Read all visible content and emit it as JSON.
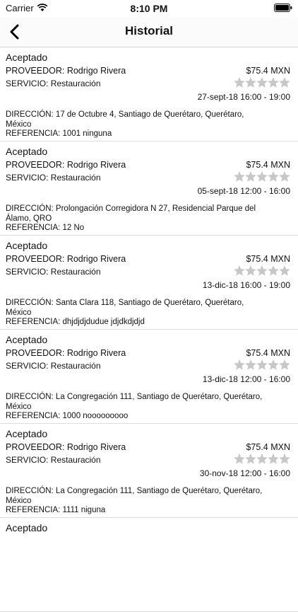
{
  "status_bar": {
    "carrier": "Carrier",
    "time": "8:10 PM"
  },
  "nav": {
    "title": "Historial"
  },
  "labels": {
    "provider_prefix": "PROVEEDOR: ",
    "service_prefix": "SERVICIO: ",
    "address_prefix": "DIRECCIÓN: ",
    "reference_prefix": "REFERENCIA: "
  },
  "items": [
    {
      "status": "Aceptado",
      "provider": "PROVEEDOR: Rodrigo Rivera",
      "price": "$75.4 MXN",
      "service": "SERVICIO: Restauración",
      "rating": 0,
      "datetime": "27-sept-18 16:00 - 19:00",
      "address": "DIRECCIÓN: 17 de Octubre 4, Santiago de Querétaro, Querétaro, México",
      "reference": "REFERENCIA: 1001 ninguna"
    },
    {
      "status": "Aceptado",
      "provider": "PROVEEDOR: Rodrigo Rivera",
      "price": "$75.4 MXN",
      "service": "SERVICIO: Restauración",
      "rating": 0,
      "datetime": "05-sept-18 12:00 - 16:00",
      "address": "DIRECCIÓN: Prolongación Corregidora N 27, Residencial Parque del Álamo, QRO",
      "reference": "REFERENCIA: 12 No"
    },
    {
      "status": "Aceptado",
      "provider": "PROVEEDOR: Rodrigo Rivera",
      "price": "$75.4 MXN",
      "service": "SERVICIO: Restauración",
      "rating": 0,
      "datetime": "13-dic-18 16:00 - 19:00",
      "address": "DIRECCIÓN: Santa Clara 118, Santiago de Querétaro, Querétaro, México",
      "reference": "REFERENCIA: dhjdjdjdudue jdjdkdjdjd"
    },
    {
      "status": "Aceptado",
      "provider": "PROVEEDOR: Rodrigo Rivera",
      "price": "$75.4 MXN",
      "service": "SERVICIO: Restauración",
      "rating": 0,
      "datetime": "13-dic-18 12:00 - 16:00",
      "address": "DIRECCIÓN: La Congregación 111, Santiago de Querétaro, Querétaro, México",
      "reference": "REFERENCIA: 1000 nooooooooo"
    },
    {
      "status": "Aceptado",
      "provider": "PROVEEDOR: Rodrigo Rivera",
      "price": "$75.4 MXN",
      "service": "SERVICIO: Restauración",
      "rating": 0,
      "datetime": "30-nov-18 12:00 - 16:00",
      "address": "DIRECCIÓN: La Congregación 111, Santiago de Querétaro, Querétaro, México",
      "reference": "REFERENCIA: 1111 niguna"
    },
    {
      "status": "Aceptado"
    }
  ],
  "colors": {
    "star_empty": "#c7c7c7",
    "separator": "#dcdcdc"
  },
  "icons": {
    "back": "chevron-left-icon",
    "star": "star-icon",
    "wifi": "wifi-icon",
    "battery": "battery-icon"
  }
}
